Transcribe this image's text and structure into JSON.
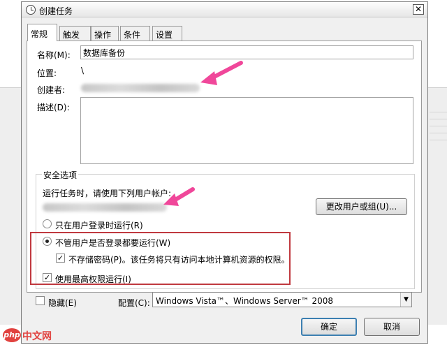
{
  "window": {
    "title": "创建任务",
    "close_glyph": "✕"
  },
  "tabs": [
    {
      "label": "常规",
      "active": true
    },
    {
      "label": "触发器"
    },
    {
      "label": "操作"
    },
    {
      "label": "条件"
    },
    {
      "label": "设置"
    }
  ],
  "general": {
    "name_label": "名称(M):",
    "name_value": "数据库备份",
    "location_label": "位置:",
    "location_value": "\\",
    "author_label": "创建者:",
    "description_label": "描述(D):"
  },
  "security": {
    "group_label": "安全选项",
    "run_as_label": "运行任务时，请使用下列用户帐户:",
    "change_user_button": "更改用户或组(U)...",
    "option_logged_on": "只在用户登录时运行(R)",
    "option_whether_logged_on": "不管用户是否登录都要运行(W)",
    "option_whether_logged_on_selected": true,
    "no_store_password": "不存储密码(P)。该任务将只有访问本地计算机资源的权限。",
    "no_store_password_checked": true,
    "highest_privileges": "使用最高权限运行(I)",
    "highest_privileges_checked": true
  },
  "footer": {
    "hidden_label": "隐藏(E)",
    "hidden_checked": false,
    "configure_label": "配置(C):",
    "configure_value": "Windows Vista™、Windows Server™ 2008",
    "ok_button": "确定",
    "cancel_button": "取消"
  },
  "watermark": {
    "logo_text": "php",
    "site_text": "中文网"
  },
  "colors": {
    "annotation_arrow": "#f0479a",
    "highlight_box": "#c0393f",
    "default_button_border": "#3c7fb1"
  }
}
